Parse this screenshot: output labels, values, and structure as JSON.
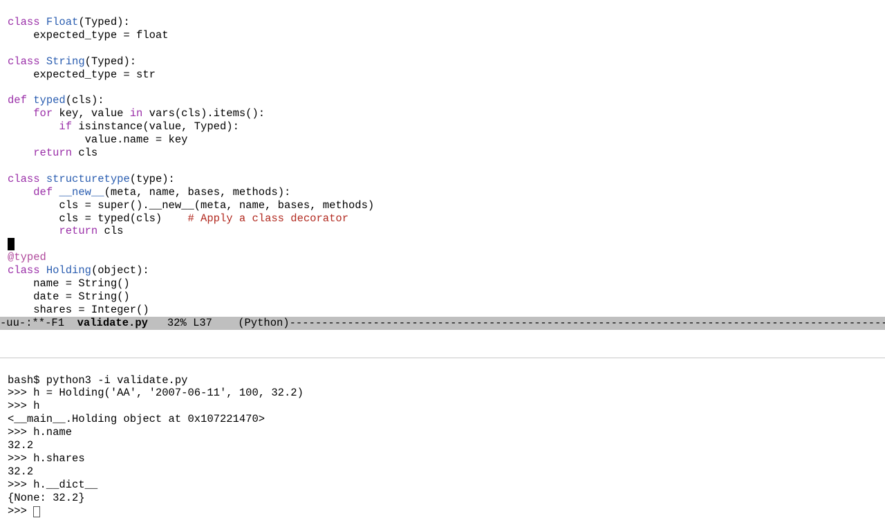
{
  "editor": {
    "l1a": "class",
    "l1b": "Float",
    "l1c": "(Typed):",
    "l2": "    expected_type = float",
    "l3": "",
    "l4a": "class",
    "l4b": "String",
    "l4c": "(Typed):",
    "l5": "    expected_type = str",
    "l6": "",
    "l7a": "def",
    "l7b": "typed",
    "l7c": "(cls):",
    "l8a": "    ",
    "l8b": "for",
    "l8c": " key, value ",
    "l8d": "in",
    "l8e": " vars(cls).items():",
    "l9a": "        ",
    "l9b": "if",
    "l9c": " isinstance(value, Typed):",
    "l10": "            value.name = key",
    "l11a": "    ",
    "l11b": "return",
    "l11c": " cls",
    "l12": "",
    "l13a": "class",
    "l13b": "structuretype",
    "l13c": "(type):",
    "l14a": "    ",
    "l14b": "def",
    "l14c": "__new__",
    "l14d": "(meta, name, bases, methods):",
    "l15": "        cls = super().__new__(meta, name, bases, methods)",
    "l16a": "        cls = typed(cls)    ",
    "l16b": "# Apply a class decorator",
    "l17a": "        ",
    "l17b": "return",
    "l17c": " cls",
    "l18": "",
    "l19": "@typed",
    "l20a": "class",
    "l20b": "Holding",
    "l20c": "(object):",
    "l21": "    name = String()",
    "l22": "    date = String()",
    "l23": "    shares = Integer()"
  },
  "modeline": {
    "left": "-uu-:**-F1  ",
    "file": "validate.py",
    "pct": "   32% ",
    "line": "L37",
    "mode": "    (Python)",
    "dashes": "------------------------------------------------------------------------------------------------------"
  },
  "term": {
    "t1": "bash$ python3 -i validate.py",
    "t2": ">>> h = Holding('AA', '2007-06-11', 100, 32.2)",
    "t3": ">>> h",
    "t4": "<__main__.Holding object at 0x107221470>",
    "t5": ">>> h.name",
    "t6": "32.2",
    "t7": ">>> h.shares",
    "t8": "32.2",
    "t9": ">>> h.__dict__",
    "t10": "{None: 32.2}",
    "t11": ">>> "
  }
}
